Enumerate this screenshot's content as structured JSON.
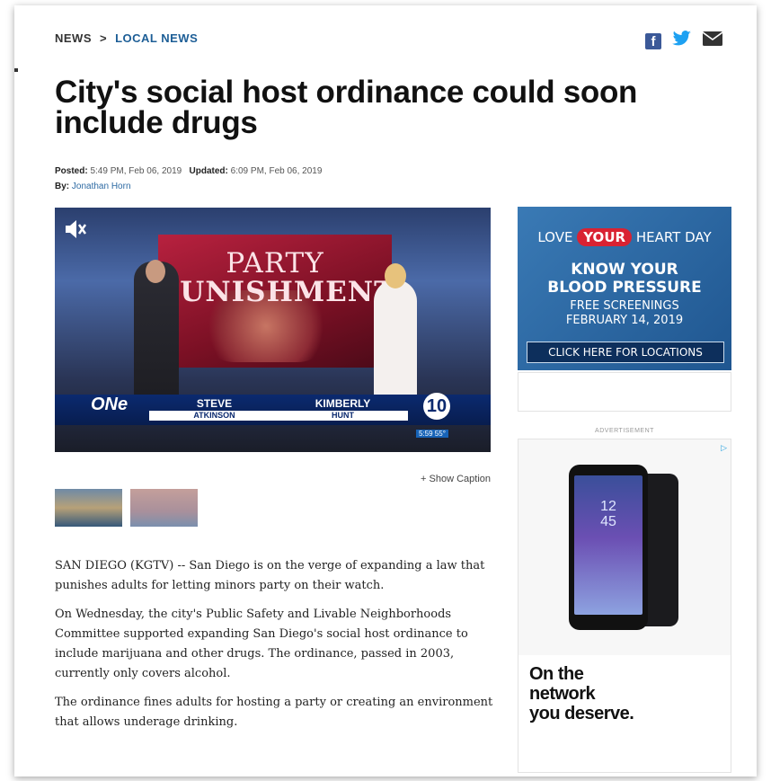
{
  "breadcrumb": {
    "section": "NEWS",
    "separator": ">",
    "subsection": "LOCAL NEWS"
  },
  "share": {
    "facebook": "f",
    "twitter": "twitter",
    "email": "email"
  },
  "headline": "City's social host ordinance could soon include drugs",
  "meta": {
    "posted_label": "Posted:",
    "posted": "5:49 PM, Feb 06, 2019",
    "updated_label": "Updated:",
    "updated": "6:09 PM, Feb 06, 2019",
    "by_label": "By:",
    "author": "Jonathan Horn"
  },
  "video": {
    "wall_line1": "PARTY",
    "wall_line2": "PUNISHMENT",
    "channel_badge": "ONe",
    "anchor1_first": "STEVE",
    "anchor1_last": "ATKINSON",
    "anchor2_first": "KIMBERLY",
    "anchor2_last": "HUNT",
    "station_logo": "10",
    "clock": "5:59  55°",
    "mute_icon": "muted-speaker"
  },
  "show_caption": "+ Show Caption",
  "article": [
    "SAN DIEGO (KGTV) -- San Diego is on the verge of expanding a law that punishes adults for letting minors party on their watch.",
    "On Wednesday, the city's Public Safety and Livable Neighborhoods Committee supported expanding San Diego's social host ordinance to include marijuana and other drugs. The ordinance, passed in 2003, currently only covers alcohol.",
    "The ordinance fines adults for hosting a party or creating an environment that allows underage drinking."
  ],
  "ad1": {
    "love": "LOVE",
    "your": "YOUR",
    "heart_day": "HEART DAY",
    "know": "KNOW YOUR",
    "bp": "BLOOD PRESSURE",
    "free": "FREE SCREENINGS",
    "date": "FEBRUARY 14, 2019",
    "cta": "CLICK HERE FOR LOCATIONS"
  },
  "ad_label": "ADVERTISEMENT",
  "ad2": {
    "time": "12\n45",
    "slogan_line1": "On the",
    "slogan_line2": "network",
    "slogan_line3": "you deserve."
  },
  "colors": {
    "link": "#1d5e96",
    "facebook": "#3b5998",
    "twitter": "#1da1f2",
    "ad_blue": "#1f5690"
  }
}
